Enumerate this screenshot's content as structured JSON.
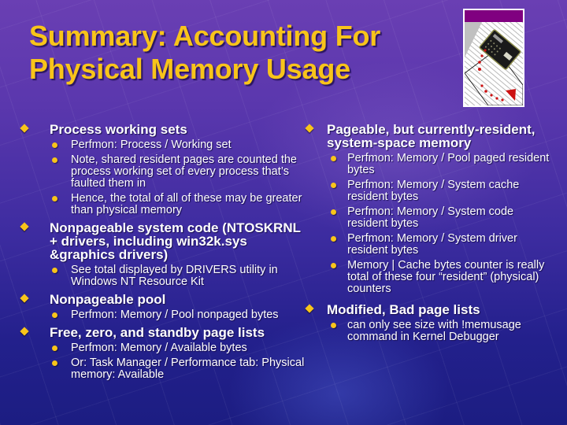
{
  "slide": {
    "title_line1": "Summary:  Accounting For",
    "title_line2": "Physical Memory Usage",
    "clipart": "calculator-on-spreadsheet-clipart",
    "colors": {
      "title": "#f8c41a",
      "bullet": "#f8c41a",
      "text": "#ffffff",
      "clipart_bar": "#800080"
    }
  },
  "left_column": [
    {
      "heading": "Process working sets",
      "items": [
        "Perfmon:  Process / Working set",
        "Note, shared resident pages are counted the process working set of every process that’s faulted them in",
        "Hence, the total of all of these may be greater than physical memory"
      ]
    },
    {
      "heading": "Nonpageable system code (NTOSKRNL + drivers, including win32k.sys &graphics drivers)",
      "items": [
        "See total displayed by DRIVERS utility in Windows NT Resource Kit"
      ]
    },
    {
      "heading": "Nonpageable pool",
      "items": [
        "Perfmon:  Memory / Pool nonpaged bytes"
      ]
    },
    {
      "heading": "Free, zero, and standby page lists",
      "items": [
        "Perfmon:  Memory / Available bytes",
        "Or:  Task Manager / Performance tab: Physical memory:  Available"
      ]
    }
  ],
  "right_column": [
    {
      "heading": "Pageable, but currently-resident, system-space memory",
      "items": [
        "Perfmon:  Memory / Pool paged resident bytes",
        "Perfmon:  Memory / System cache resident bytes",
        "Perfmon:  Memory / System code resident bytes",
        "Perfmon:  Memory / System driver resident bytes",
        "Memory | Cache bytes counter is really total of these four “resident” (physical) counters"
      ]
    },
    {
      "heading": "Modified, Bad page lists",
      "items": [
        "can only see size with !memusage command in Kernel Debugger"
      ]
    }
  ]
}
